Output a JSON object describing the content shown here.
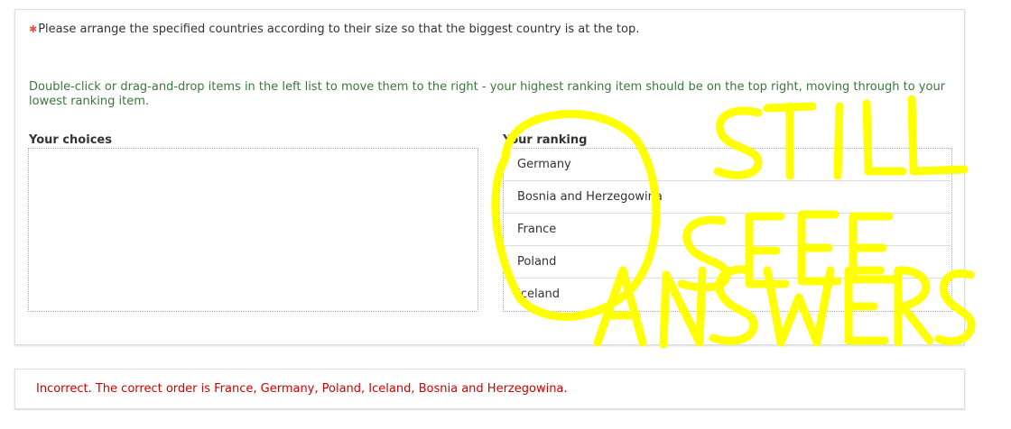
{
  "question": {
    "required_marker": "✱",
    "text": "Please arrange the specified countries according to their size so that the biggest country is at the top.",
    "help": "Double-click or drag-and-drop items in the left list to move them to the right - your highest ranking item should be on the top right, moving through to your lowest ranking item."
  },
  "choices": {
    "label": "Your choices",
    "items": []
  },
  "ranking": {
    "label": "Your ranking",
    "items": [
      {
        "label": "Germany"
      },
      {
        "label": "Bosnia and Herzegowina"
      },
      {
        "label": "France"
      },
      {
        "label": "Poland"
      },
      {
        "label": "Iceland"
      }
    ]
  },
  "result": {
    "text": "Incorrect. The correct order is France, Germany, Poland, Iceland, Bosnia and Herzegowina."
  },
  "annotation": {
    "text": "STILL SEE ANSWERS",
    "color": "#ffff00"
  },
  "colors": {
    "help_text": "#3c763d",
    "error_text": "#cc0000",
    "required_marker": "#d9534f"
  }
}
